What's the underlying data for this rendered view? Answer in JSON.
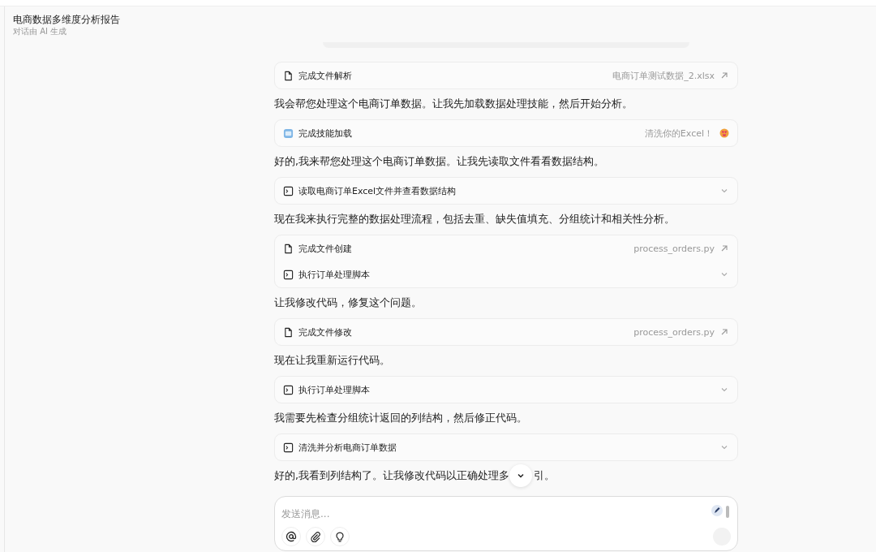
{
  "header": {
    "title": "电商数据多维度分析报告",
    "subtitle": "对话由 AI 生成"
  },
  "messages": [
    {
      "kind": "card",
      "rows": [
        {
          "kind": "file",
          "label": "完成文件解析",
          "meta": "电商订单测试数据_2.xlsx"
        }
      ]
    },
    {
      "kind": "text",
      "text": "我会帮您处理这个电商订单数据。让我先加载数据处理技能，然后开始分析。"
    },
    {
      "kind": "card",
      "rows": [
        {
          "kind": "skill",
          "label": "完成技能加载",
          "meta": "清洗你的Excel！"
        }
      ]
    },
    {
      "kind": "text",
      "text": "好的,我来帮您处理这个电商订单数据。让我先读取文件看看数据结构。"
    },
    {
      "kind": "card",
      "rows": [
        {
          "kind": "command",
          "label": "读取电商订单Excel文件并查看数据结构"
        }
      ]
    },
    {
      "kind": "text",
      "text": "现在我来执行完整的数据处理流程，包括去重、缺失值填充、分组统计和相关性分析。"
    },
    {
      "kind": "card",
      "rows": [
        {
          "kind": "file",
          "label": "完成文件创建",
          "meta": "process_orders.py"
        },
        {
          "kind": "command",
          "label": "执行订单处理脚本"
        }
      ]
    },
    {
      "kind": "text",
      "text": "让我修改代码，修复这个问题。"
    },
    {
      "kind": "card",
      "rows": [
        {
          "kind": "file",
          "label": "完成文件修改",
          "meta": "process_orders.py"
        }
      ]
    },
    {
      "kind": "text",
      "text": "现在让我重新运行代码。"
    },
    {
      "kind": "card",
      "rows": [
        {
          "kind": "command",
          "label": "执行订单处理脚本"
        }
      ]
    },
    {
      "kind": "text",
      "text": "我需要先检查分组统计返回的列结构，然后修正代码。"
    },
    {
      "kind": "card",
      "rows": [
        {
          "kind": "command",
          "label": "清洗并分析电商订单数据"
        }
      ]
    },
    {
      "kind": "covered",
      "before": "好的,我看到列结构了。让我修改代码以正确处理多",
      "after": "引。"
    }
  ],
  "composer": {
    "placeholder": "发送消息...",
    "send_disabled": true
  }
}
